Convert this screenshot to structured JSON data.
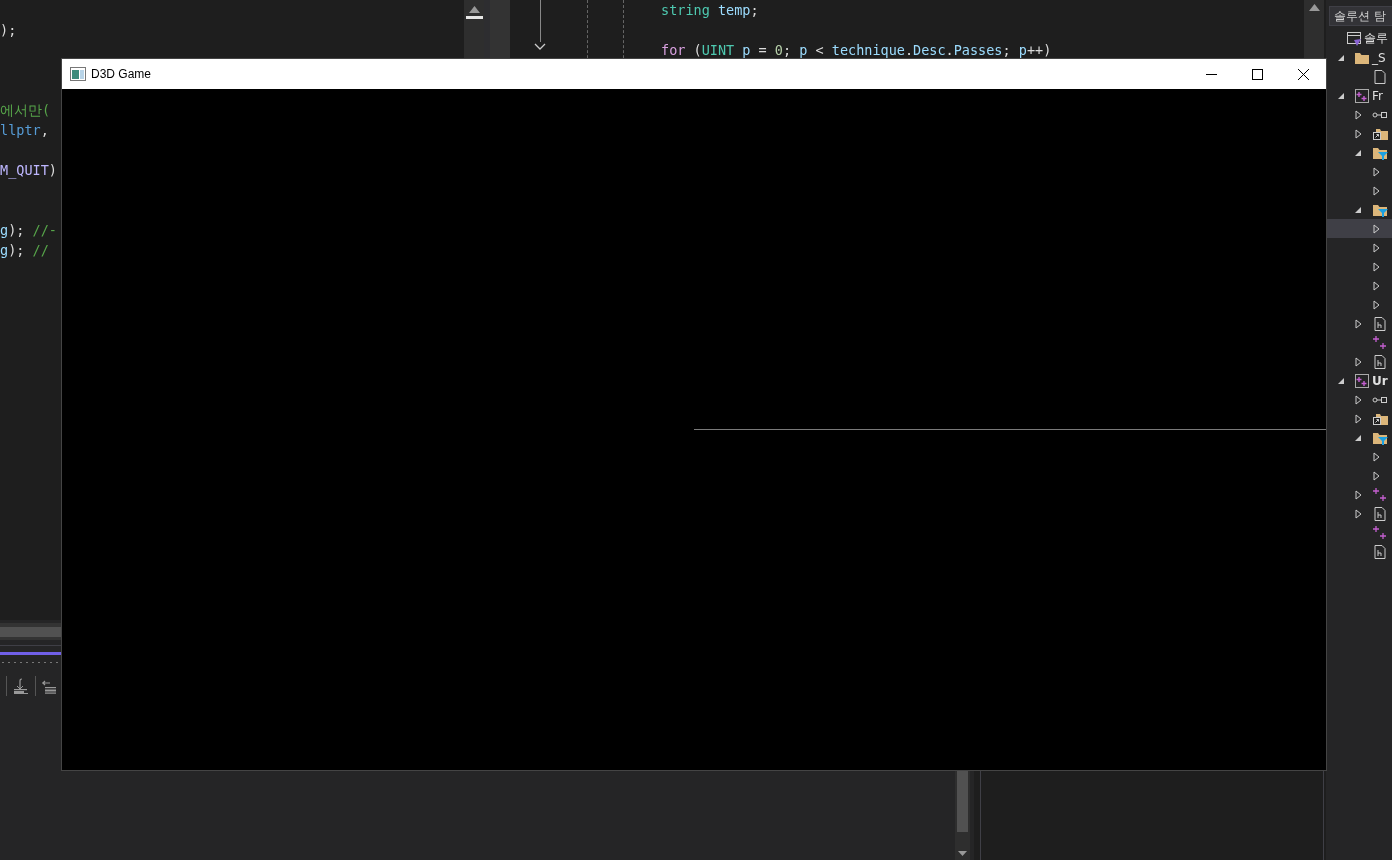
{
  "left_editor": {
    "lines": [
      {
        "kind": "blank"
      },
      {
        "kind": "code",
        "tokens": [
          {
            "kind": "plain",
            "text": ");"
          }
        ]
      },
      {
        "kind": "blank"
      },
      {
        "kind": "blank"
      },
      {
        "kind": "blank"
      },
      {
        "kind": "code",
        "tokens": [
          {
            "kind": "comment",
            "text": "에서만("
          }
        ]
      },
      {
        "kind": "code",
        "tokens": [
          {
            "kind": "keyword",
            "text": "llptr"
          },
          {
            "kind": "plain",
            "text": ","
          }
        ]
      },
      {
        "kind": "blank"
      },
      {
        "kind": "code",
        "tokens": [
          {
            "kind": "macro",
            "text": "M_QUIT"
          },
          {
            "kind": "plain",
            "text": ")"
          }
        ]
      },
      {
        "kind": "blank"
      },
      {
        "kind": "blank"
      },
      {
        "kind": "code",
        "tokens": [
          {
            "kind": "ident",
            "text": "g"
          },
          {
            "kind": "plain",
            "text": "); "
          },
          {
            "kind": "comment",
            "text": "//-"
          }
        ]
      },
      {
        "kind": "code",
        "tokens": [
          {
            "kind": "ident",
            "text": "g"
          },
          {
            "kind": "plain",
            "text": "); "
          },
          {
            "kind": "comment",
            "text": "//"
          }
        ]
      }
    ]
  },
  "right_editor": {
    "lines": [
      {
        "kind": "code",
        "tokens": [
          {
            "kind": "type",
            "text": "string "
          },
          {
            "kind": "ident",
            "text": "temp"
          },
          {
            "kind": "plain",
            "text": ";"
          }
        ]
      },
      {
        "kind": "blank"
      },
      {
        "kind": "code",
        "tokens": [
          {
            "kind": "control",
            "text": "for"
          },
          {
            "kind": "plain",
            "text": " ("
          },
          {
            "kind": "type",
            "text": "UINT "
          },
          {
            "kind": "ident",
            "text": "p"
          },
          {
            "kind": "plain",
            "text": " = "
          },
          {
            "kind": "number",
            "text": "0"
          },
          {
            "kind": "plain",
            "text": "; "
          },
          {
            "kind": "ident",
            "text": "p"
          },
          {
            "kind": "plain",
            "text": " < "
          },
          {
            "kind": "ident",
            "text": "technique"
          },
          {
            "kind": "plain",
            "text": "."
          },
          {
            "kind": "ident",
            "text": "Desc"
          },
          {
            "kind": "plain",
            "text": "."
          },
          {
            "kind": "ident",
            "text": "Passes"
          },
          {
            "kind": "plain",
            "text": "; "
          },
          {
            "kind": "ident",
            "text": "p"
          },
          {
            "kind": "plain",
            "text": "++)"
          }
        ]
      }
    ]
  },
  "solution_explorer": {
    "search": {
      "placeholder": "솔루션 탐"
    },
    "tree": [
      {
        "kind": "solution",
        "label": "솔루",
        "selected": false,
        "children": [
          {
            "kind": "folder",
            "label": "_S",
            "expanded": true,
            "selected": false,
            "children": [
              {
                "kind": "file",
                "selected": false
              }
            ]
          },
          {
            "kind": "project",
            "label": "Fr",
            "startup": false,
            "expanded": true,
            "selected": false,
            "children": [
              {
                "kind": "references",
                "expanded": false,
                "selected": false
              },
              {
                "kind": "external",
                "expanded": false,
                "selected": false
              },
              {
                "kind": "filter",
                "expanded": true,
                "selected": false,
                "children": [
                  {
                    "expanded": false,
                    "selected": false
                  },
                  {
                    "expanded": false,
                    "selected": false
                  }
                ]
              },
              {
                "kind": "filter",
                "expanded": true,
                "selected": false,
                "children": [
                  {
                    "expanded": false,
                    "selected": true
                  },
                  {
                    "expanded": false,
                    "selected": false
                  },
                  {
                    "expanded": false,
                    "selected": false
                  },
                  {
                    "expanded": false,
                    "selected": false
                  },
                  {
                    "expanded": false,
                    "selected": false
                  }
                ]
              },
              {
                "kind": "header",
                "expanded": false,
                "selected": false
              },
              {
                "kind": "source",
                "selected": false
              },
              {
                "kind": "header",
                "expanded": false,
                "selected": false
              }
            ]
          },
          {
            "kind": "project",
            "label": "Ur",
            "startup": true,
            "expanded": true,
            "selected": false,
            "children": [
              {
                "kind": "references",
                "expanded": false,
                "selected": false
              },
              {
                "kind": "external",
                "expanded": false,
                "selected": false
              },
              {
                "kind": "filter",
                "expanded": true,
                "selected": false,
                "children": [
                  {
                    "expanded": false,
                    "selected": false
                  },
                  {
                    "expanded": false,
                    "selected": false
                  }
                ]
              },
              {
                "kind": "source",
                "expanded": false,
                "selected": false
              },
              {
                "kind": "header",
                "expanded": false,
                "selected": false
              },
              {
                "kind": "source",
                "selected": false
              },
              {
                "kind": "header",
                "selected": false
              }
            ]
          }
        ]
      }
    ]
  },
  "game_window": {
    "title": "D3D Game"
  }
}
